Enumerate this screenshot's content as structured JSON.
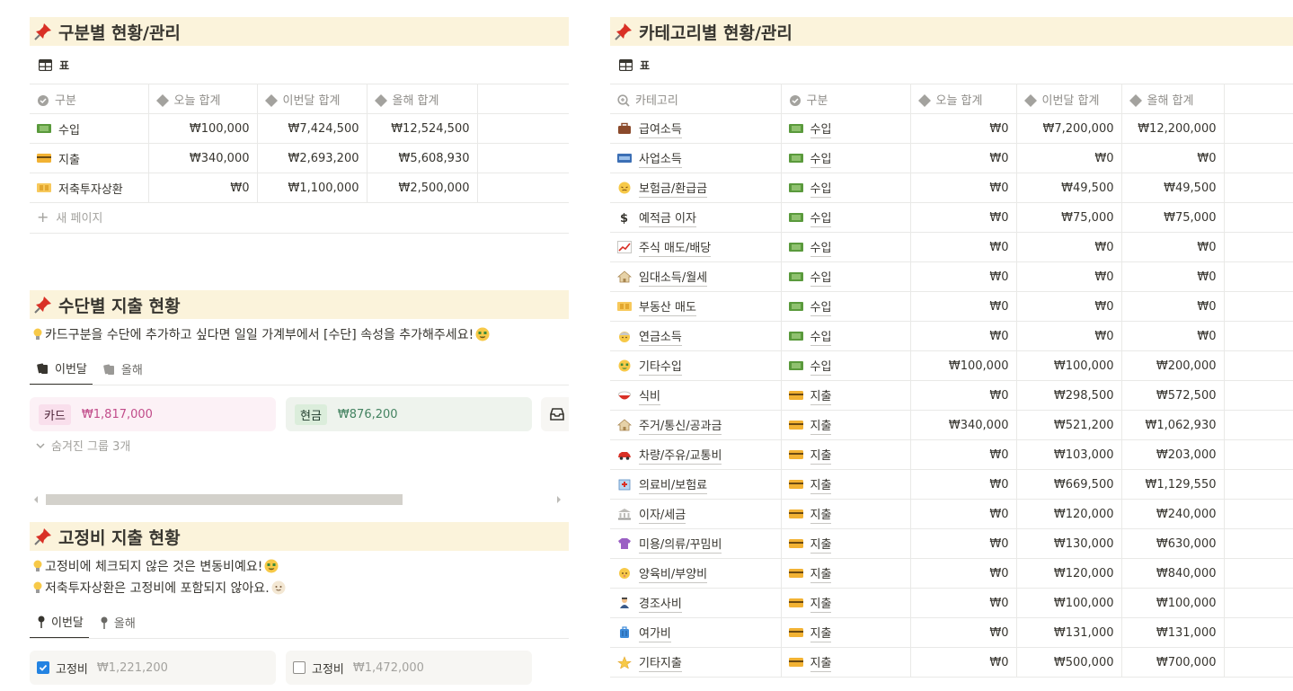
{
  "left": {
    "section1": {
      "title": "구분별 현황/관리",
      "view_label": "표",
      "columns": [
        "구분",
        "오늘 합계",
        "이번달 합계",
        "올해 합계"
      ],
      "rows": [
        {
          "name": "수입",
          "icon": "money-icon",
          "today": "₩100,000",
          "month": "₩7,424,500",
          "year": "₩12,524,500"
        },
        {
          "name": "지출",
          "icon": "credit-card-icon",
          "today": "₩340,000",
          "month": "₩2,693,200",
          "year": "₩5,608,930"
        },
        {
          "name": "저축투자상환",
          "icon": "coins-icon",
          "today": "₩0",
          "month": "₩1,100,000",
          "year": "₩2,500,000"
        }
      ],
      "new_page": "새 페이지"
    },
    "section2": {
      "title": "수단별 지출 현황",
      "callout": "카드구분을 수단에 추가하고 싶다면 일일 가계부에서 [수단] 속성을 추가해주세요!",
      "tabs": [
        "이번달",
        "올해"
      ],
      "cards": [
        {
          "tag": "카드",
          "amount": "₩1,817,000"
        },
        {
          "tag": "현금",
          "amount": "₩876,200"
        }
      ],
      "hidden_groups": "숨겨진 그룹 3개"
    },
    "section3": {
      "title": "고정비 지출 현황",
      "callouts": [
        "고정비에 체크되지 않은 것은 변동비예요!",
        "저축투자상환은 고정비에 포함되지 않아요."
      ],
      "tabs": [
        "이번달",
        "올해"
      ],
      "cards": [
        {
          "label": "고정비",
          "amount": "₩1,221,200",
          "checked": true
        },
        {
          "label": "고정비",
          "amount": "₩1,472,000",
          "checked": false
        }
      ]
    }
  },
  "right": {
    "title": "카테고리별 현황/관리",
    "view_label": "표",
    "columns": [
      "카테고리",
      "구분",
      "오늘 합계",
      "이번달 합계",
      "올해 합계"
    ],
    "rows": [
      {
        "name": "급여소득",
        "icon": "briefcase-icon",
        "type": "수입",
        "today": "₩0",
        "month": "₩7,200,000",
        "year": "₩12,200,000"
      },
      {
        "name": "사업소득",
        "icon": "atm-icon",
        "type": "수입",
        "today": "₩0",
        "month": "₩0",
        "year": "₩0"
      },
      {
        "name": "보험금/환급금",
        "icon": "face-icon",
        "type": "수입",
        "today": "₩0",
        "month": "₩49,500",
        "year": "₩49,500"
      },
      {
        "name": "예적금 이자",
        "icon": "dollar-icon",
        "type": "수입",
        "today": "₩0",
        "month": "₩75,000",
        "year": "₩75,000"
      },
      {
        "name": "주식 매도/배당",
        "icon": "chart-up-icon",
        "type": "수입",
        "today": "₩0",
        "month": "₩0",
        "year": "₩0"
      },
      {
        "name": "임대소득/월세",
        "icon": "house-icon",
        "type": "수입",
        "today": "₩0",
        "month": "₩0",
        "year": "₩0"
      },
      {
        "name": "부동산 매도",
        "icon": "coins-icon",
        "type": "수입",
        "today": "₩0",
        "month": "₩0",
        "year": "₩0"
      },
      {
        "name": "연금소득",
        "icon": "elder-icon",
        "type": "수입",
        "today": "₩0",
        "month": "₩0",
        "year": "₩0"
      },
      {
        "name": "기타수입",
        "icon": "money-face-icon",
        "type": "수입",
        "today": "₩100,000",
        "month": "₩100,000",
        "year": "₩200,000"
      },
      {
        "name": "식비",
        "icon": "bowl-icon",
        "type": "지출",
        "today": "₩0",
        "month": "₩298,500",
        "year": "₩572,500"
      },
      {
        "name": "주거/통신/공과금",
        "icon": "house-icon",
        "type": "지출",
        "today": "₩340,000",
        "month": "₩521,200",
        "year": "₩1,062,930"
      },
      {
        "name": "차량/주유/교통비",
        "icon": "car-icon",
        "type": "지출",
        "today": "₩0",
        "month": "₩103,000",
        "year": "₩203,000"
      },
      {
        "name": "의료비/보험료",
        "icon": "hospital-icon",
        "type": "지출",
        "today": "₩0",
        "month": "₩669,500",
        "year": "₩1,129,550"
      },
      {
        "name": "이자/세금",
        "icon": "bank-icon",
        "type": "지출",
        "today": "₩0",
        "month": "₩120,000",
        "year": "₩240,000"
      },
      {
        "name": "미용/의류/꾸밈비",
        "icon": "shirt-icon",
        "type": "지출",
        "today": "₩0",
        "month": "₩130,000",
        "year": "₩630,000"
      },
      {
        "name": "양육비/부양비",
        "icon": "baby-icon",
        "type": "지출",
        "today": "₩0",
        "month": "₩120,000",
        "year": "₩840,000"
      },
      {
        "name": "경조사비",
        "icon": "person-icon",
        "type": "지출",
        "today": "₩0",
        "month": "₩100,000",
        "year": "₩100,000"
      },
      {
        "name": "여가비",
        "icon": "luggage-icon",
        "type": "지출",
        "today": "₩0",
        "month": "₩131,000",
        "year": "₩131,000"
      },
      {
        "name": "기타지출",
        "icon": "star-icon",
        "type": "지출",
        "today": "₩0",
        "month": "₩500,000",
        "year": "₩700,000"
      }
    ]
  },
  "colors": {
    "header_bg": "#fbf3db",
    "card_pink": "#fcf1f6",
    "card_green": "#eef3ed",
    "tag_pink": "#f9dfec",
    "tag_green": "#dbeddb",
    "checkbox_blue": "#2383e2"
  }
}
